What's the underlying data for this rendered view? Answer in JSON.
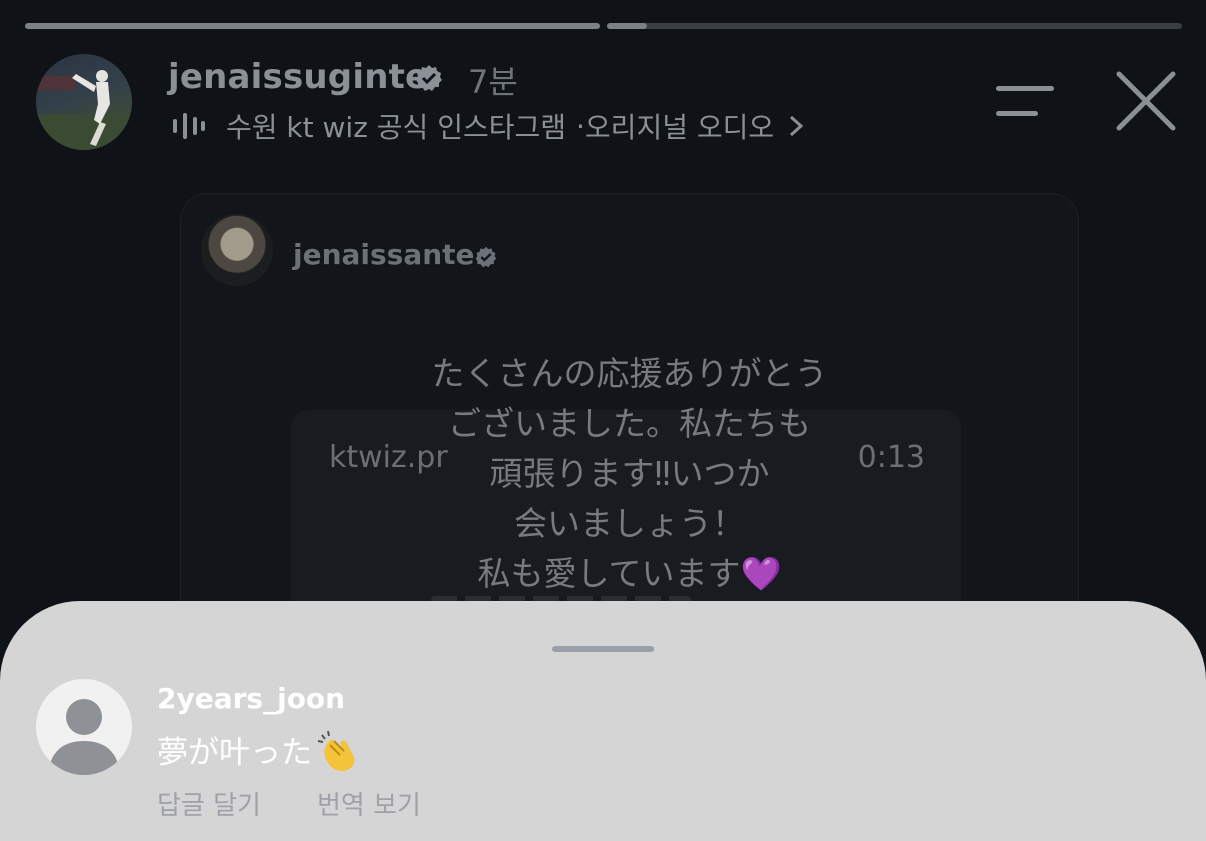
{
  "story": {
    "progress": [
      1.0,
      0.07
    ],
    "username": "jenaissuginte",
    "verified": true,
    "time_ago": "7분",
    "audio": {
      "title": "수원 kt wiz 공식 인스타그램",
      "separator": " · ",
      "type": "오리지널 오디오"
    },
    "icons": {
      "menu": "menu-icon",
      "close": "close-icon",
      "audio": "audio-bars-icon",
      "chevron": "chevron-right-icon"
    }
  },
  "shared_post": {
    "username": "jenaissante",
    "verified": true,
    "message_lines": [
      "たくさんの応援ありがとう",
      "ございました。私たちも",
      "頑張ります‼︎いつか",
      "会いましょう！",
      "私も愛しています💜"
    ],
    "reel": {
      "name": "ktwiz.pr",
      "duration": "0:13"
    }
  },
  "comment": {
    "username": "2years_joon",
    "text": "夢が叶った",
    "emoji_icon": "clapping-hands-icon",
    "reply_label": "답글 달기",
    "translate_label": "번역 보기"
  },
  "colors": {
    "background": "#0f1318",
    "sheet": "#d5d5d5",
    "muted_text": "#8b8f96"
  }
}
